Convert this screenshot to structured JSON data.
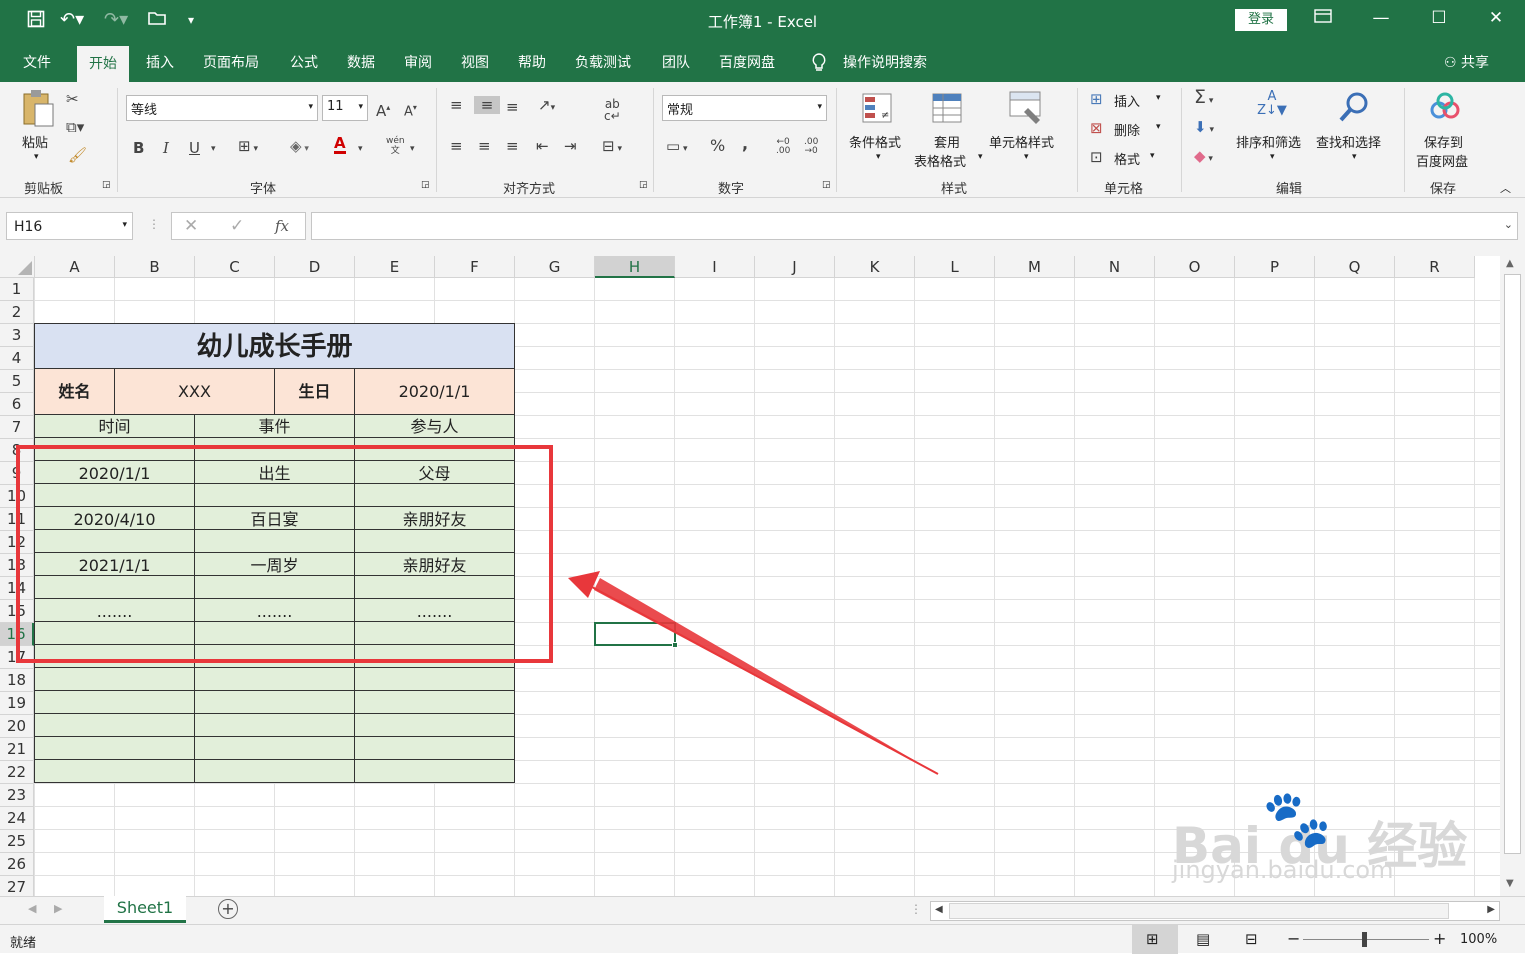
{
  "window": {
    "title": "工作簿1  -  Excel",
    "login_label": "登录"
  },
  "menu": {
    "items": [
      "文件",
      "开始",
      "插入",
      "页面布局",
      "公式",
      "数据",
      "审阅",
      "视图",
      "帮助",
      "负载测试",
      "团队",
      "百度网盘"
    ],
    "search": "操作说明搜索",
    "share": "共享"
  },
  "ribbon": {
    "clipboard": {
      "paste": "粘贴",
      "group": "剪贴板"
    },
    "font": {
      "name": "等线",
      "size": "11",
      "group": "字体",
      "bold": "B",
      "italic": "I",
      "underline": "U",
      "phonetic": "wén"
    },
    "alignment": {
      "group": "对齐方式"
    },
    "number": {
      "format": "常规",
      "percent": "%",
      "comma": ",",
      "group": "数字"
    },
    "styles": {
      "conditional": "条件格式",
      "table_l1": "套用",
      "table_l2": "表格格式",
      "cell_styles": "单元格样式",
      "group": "样式"
    },
    "cells": {
      "insert": "插入",
      "delete": "删除",
      "format": "格式",
      "group": "单元格"
    },
    "editing": {
      "sort": "排序和筛选",
      "find": "查找和选择",
      "group": "编辑"
    },
    "save": {
      "l1": "保存到",
      "l2": "百度网盘",
      "group": "保存"
    }
  },
  "formula_bar": {
    "name_box": "H16",
    "fx": "fx",
    "value": ""
  },
  "columns": [
    "A",
    "B",
    "C",
    "D",
    "E",
    "F",
    "G",
    "H",
    "I",
    "J",
    "K",
    "L",
    "M",
    "N",
    "O",
    "P",
    "Q",
    "R"
  ],
  "rows": [
    "1",
    "2",
    "3",
    "4",
    "5",
    "6",
    "7",
    "8",
    "9",
    "10",
    "11",
    "12",
    "13",
    "14",
    "15",
    "16",
    "17",
    "18",
    "19",
    "20",
    "21",
    "22",
    "23",
    "24",
    "25",
    "26",
    "27"
  ],
  "sheet": {
    "title": "幼儿成长手册",
    "name_label": "姓名",
    "name_value": "XXX",
    "birth_label": "生日",
    "birth_value": "2020/1/1",
    "headers": [
      "时间",
      "事件",
      "参与人"
    ],
    "records": [
      {
        "time": "2020/1/1",
        "event": "出生",
        "people": "父母"
      },
      {
        "time": "2020/4/10",
        "event": "百日宴",
        "people": "亲朋好友"
      },
      {
        "time": "2021/1/1",
        "event": "一周岁",
        "people": "亲朋好友"
      },
      {
        "time": ".......",
        "event": ".......",
        "people": "......."
      }
    ]
  },
  "tabs": {
    "sheet1": "Sheet1"
  },
  "status": {
    "ready": "就绪",
    "zoom": "100%"
  },
  "watermark": {
    "brand": "Bai du 经验",
    "url": "jingyan.baidu.com"
  },
  "colors": {
    "excel_green": "#217346",
    "title_fill": "#d9e1f2",
    "info_fill": "#fce4d6",
    "table_fill": "#e2efda",
    "annotation_red": "#e8373b"
  }
}
